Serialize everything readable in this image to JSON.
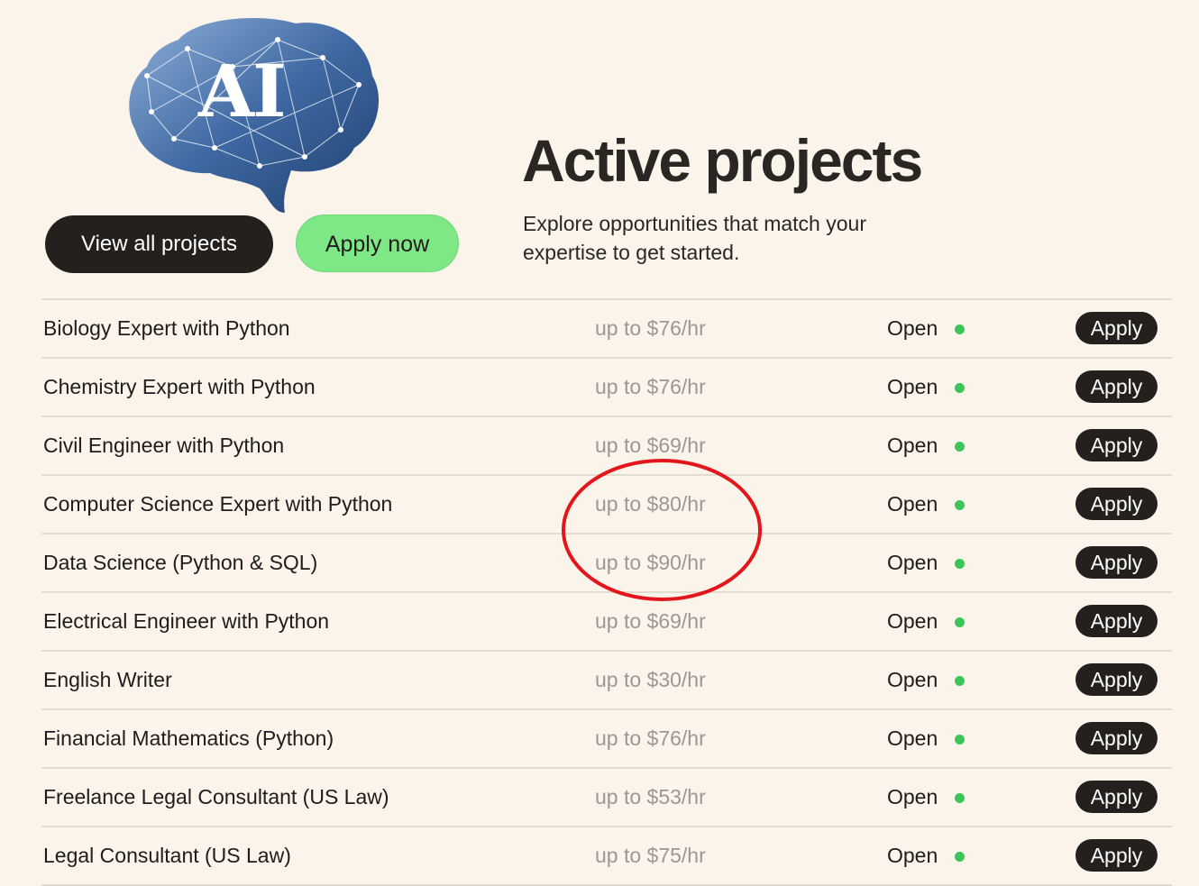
{
  "logo": {
    "text": "AI"
  },
  "header": {
    "view_all_label": "View all projects",
    "apply_now_label": "Apply now",
    "title": "Active projects",
    "subtitle": "Explore opportunities that match your expertise to get started."
  },
  "projects": [
    {
      "name": "Biology Expert with Python",
      "rate": "up to $76/hr",
      "status": "Open",
      "action": "Apply"
    },
    {
      "name": "Chemistry Expert with Python",
      "rate": "up to $76/hr",
      "status": "Open",
      "action": "Apply"
    },
    {
      "name": "Civil Engineer with Python",
      "rate": "up to $69/hr",
      "status": "Open",
      "action": "Apply"
    },
    {
      "name": "Computer Science Expert with Python",
      "rate": "up to $80/hr",
      "status": "Open",
      "action": "Apply"
    },
    {
      "name": "Data Science (Python & SQL)",
      "rate": "up to $90/hr",
      "status": "Open",
      "action": "Apply"
    },
    {
      "name": "Electrical Engineer with Python",
      "rate": "up to $69/hr",
      "status": "Open",
      "action": "Apply"
    },
    {
      "name": "English Writer",
      "rate": "up to $30/hr",
      "status": "Open",
      "action": "Apply"
    },
    {
      "name": "Financial Mathematics (Python)",
      "rate": "up to $76/hr",
      "status": "Open",
      "action": "Apply"
    },
    {
      "name": "Freelance Legal Consultant (US Law)",
      "rate": "up to $53/hr",
      "status": "Open",
      "action": "Apply"
    },
    {
      "name": "Legal Consultant (US Law)",
      "rate": "up to $75/hr",
      "status": "Open",
      "action": "Apply"
    }
  ],
  "colors": {
    "background": "#faf4ea",
    "dark_button": "#24201d",
    "accent_green": "#7ee886",
    "status_dot": "#3cc65a",
    "annotation_red": "#e3161c"
  },
  "annotation": {
    "icon": "red-ellipse-annotation",
    "circled_rows": [
      3,
      4
    ]
  }
}
